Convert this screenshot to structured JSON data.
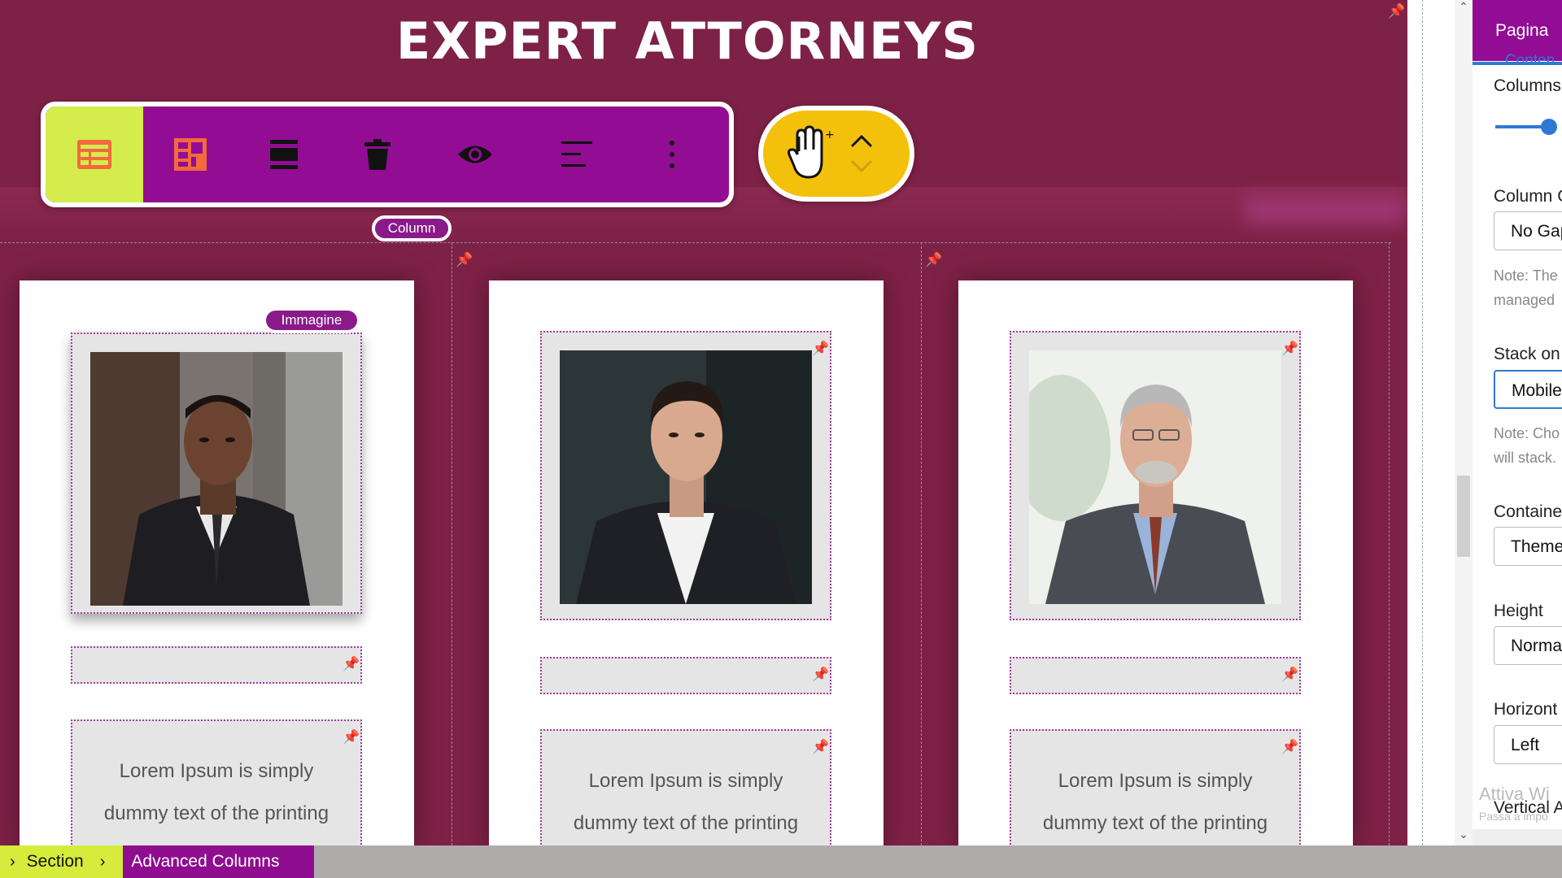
{
  "heading": "EXPERT ATTORNEYS",
  "toolbar": {
    "buttons": [
      "layout-select",
      "column-layout",
      "rows",
      "delete",
      "visibility",
      "align",
      "more"
    ]
  },
  "mover": {
    "icons": [
      "drag-hand-icon",
      "chevron-up-icon",
      "chevron-down-icon"
    ]
  },
  "labels": {
    "column": "Column",
    "image": "Immagine"
  },
  "cards": [
    {
      "text": "Lorem Ipsum is simply dummy text of the printing and typesetting industry."
    },
    {
      "text": "Lorem Ipsum is simply dummy text of the printing"
    },
    {
      "text": "Lorem Ipsum is simply dummy text of the printing"
    }
  ],
  "panel": {
    "tab": "Pagina",
    "sub_tab": "Conten",
    "columns_label": "Columns",
    "column_gap_label": "Column G",
    "column_gap_value": "No Gap",
    "note1_line1": "Note: The",
    "note1_line2": "managed",
    "stack_label": "Stack on",
    "stack_value": "Mobile",
    "note2_line1": "Note: Cho",
    "note2_line2": "will stack.",
    "container_label": "Containe",
    "container_value": "Theme",
    "height_label": "Height",
    "height_value": "Norma",
    "horizontal_label": "Horizont",
    "horizontal_value": "Left",
    "vertical_label": "Vertical A",
    "watermark_line1": "Attiva Wi",
    "watermark_line2": "Passa a impo"
  },
  "breadcrumb": {
    "section": "Section",
    "advanced": "Advanced Columns"
  },
  "colors": {
    "canvas": "#7e2146",
    "toolbar": "#930d94",
    "toolbar_active": "#d4ec4c",
    "mover": "#f3c10b",
    "accent_blue": "#2e78d2"
  }
}
